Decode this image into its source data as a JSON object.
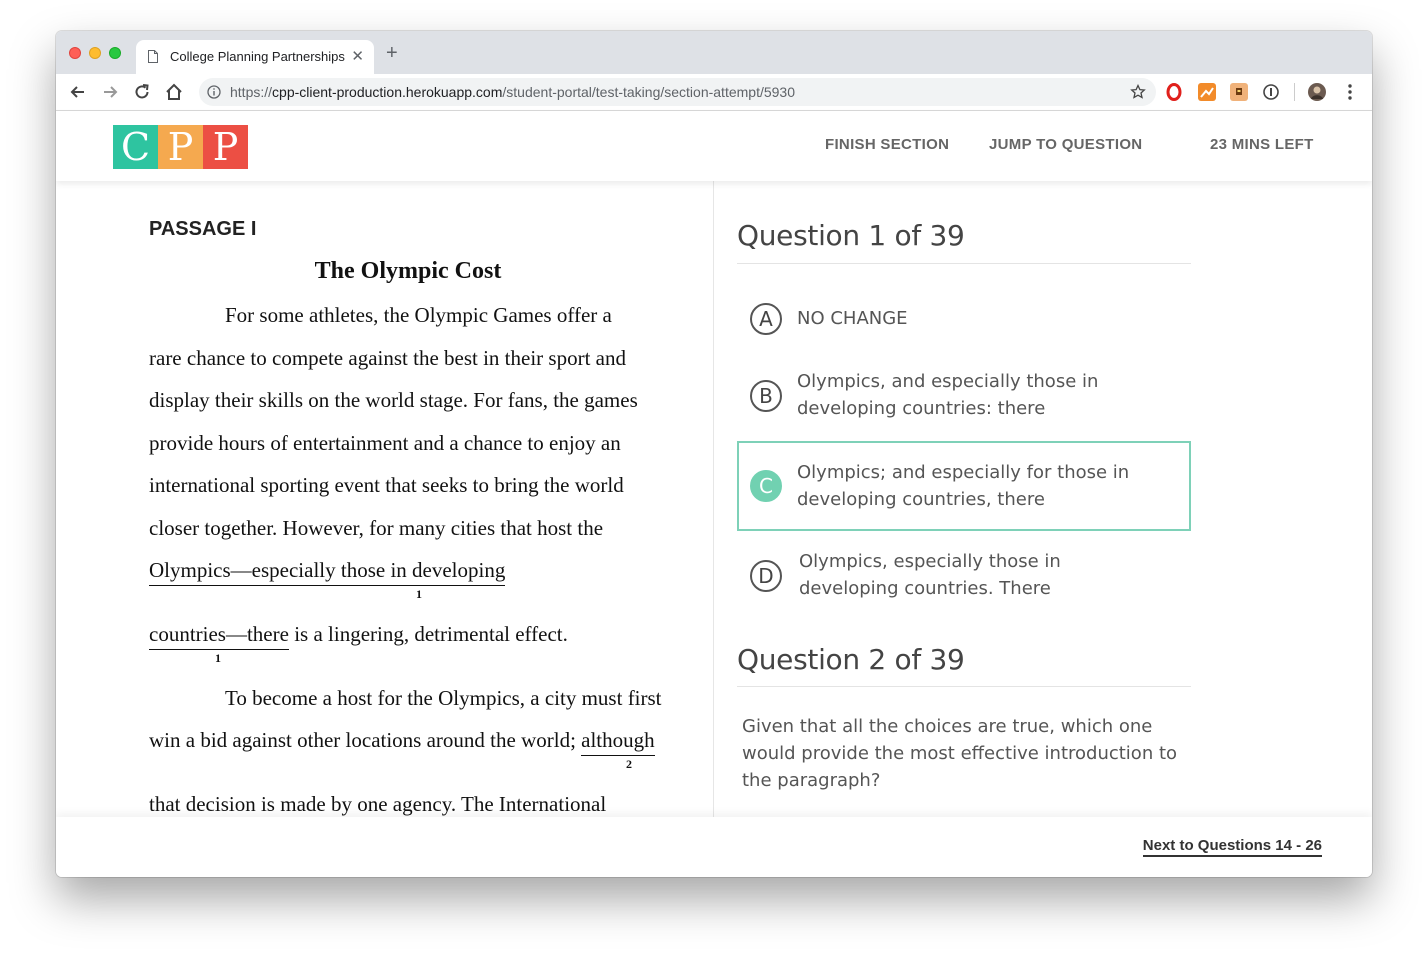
{
  "browser": {
    "tab_title": "College Planning Partnerships",
    "url_scheme": "https://",
    "url_host": "cpp-client-production.herokuapp.com",
    "url_path": "/student-portal/test-taking/section-attempt/5930"
  },
  "header": {
    "logo_letters": [
      "C",
      "P",
      "P"
    ],
    "logo_colors": [
      "#2ec4a0",
      "#f5a94f",
      "#ec4f44"
    ],
    "finish_label": "FINISH SECTION",
    "jump_label": "JUMP TO QUESTION",
    "time_left": "23 MINS LEFT"
  },
  "passage": {
    "label": "PASSAGE I",
    "title": "The Olympic Cost",
    "lines": {
      "l1": "For some athletes, the Olympic Games offer a",
      "l2": "rare chance to compete against the best in their sport and",
      "l3": "display their skills on the world stage. For fans, the games",
      "l4": "provide hours of entertainment and a chance to enjoy an",
      "l5": "international sporting event that seeks to bring the world",
      "l6": "closer together. However, for many cities that host the",
      "l7_under": "Olympics—especially those in developing",
      "l8_under": "countries—there",
      "l8_rest": " is a lingering, detrimental effect.",
      "l9": "To become a host for the Olympics, a city must first",
      "l10_pre": "win a bid against other locations around the world; ",
      "l10_under": "although",
      "l11": "that decision is made by one agency. The International"
    },
    "ref1": "1",
    "ref2": "2"
  },
  "question1": {
    "heading": "Question 1 of 39",
    "selected": "C",
    "choices": [
      {
        "letter": "A",
        "text": "NO CHANGE"
      },
      {
        "letter": "B",
        "text": "Olympics, and especially those in developing countries: there"
      },
      {
        "letter": "C",
        "text": "Olympics; and especially for those in developing countries, there"
      },
      {
        "letter": "D",
        "text": "Olympics, especially those in developing countries. There"
      }
    ]
  },
  "question2": {
    "heading": "Question 2 of 39",
    "prompt": "Given that all the choices are true, which one would provide the most effective introduction to the paragraph?"
  },
  "footer": {
    "next_label": "Next to Questions 14 - 26"
  }
}
